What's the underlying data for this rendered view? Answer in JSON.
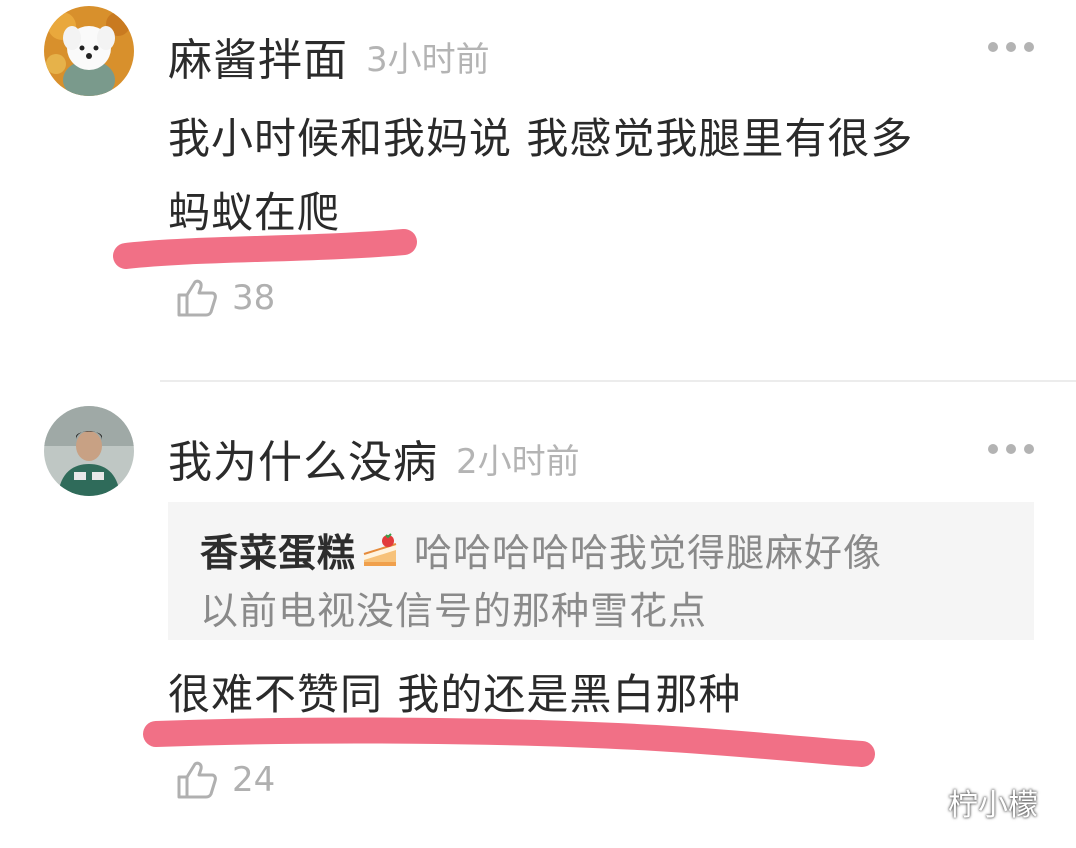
{
  "comments": [
    {
      "username": "麻酱拌面",
      "time": "3小时前",
      "lines": [
        "我小时候和我妈说 我感觉我腿里有很多",
        "蚂蚁在爬"
      ],
      "likes": "38"
    },
    {
      "username": "我为什么没病",
      "time": "2小时前",
      "quote": {
        "name": "香菜蛋糕",
        "line1": "哈哈哈哈哈我觉得腿麻好像",
        "line2": "以前电视没信号的那种雪花点"
      },
      "lines": [
        "很难不赞同 我的还是黑白那种"
      ],
      "likes": "24"
    }
  ],
  "icons": {
    "more": "more-dots-icon",
    "like": "thumbs-up-icon",
    "emoji": "cake-emoji-icon",
    "watermark": "wechat-icon"
  },
  "colors": {
    "highlight": "#f0647c",
    "muted": "#b4b4b4"
  },
  "watermark": "柠小檬"
}
